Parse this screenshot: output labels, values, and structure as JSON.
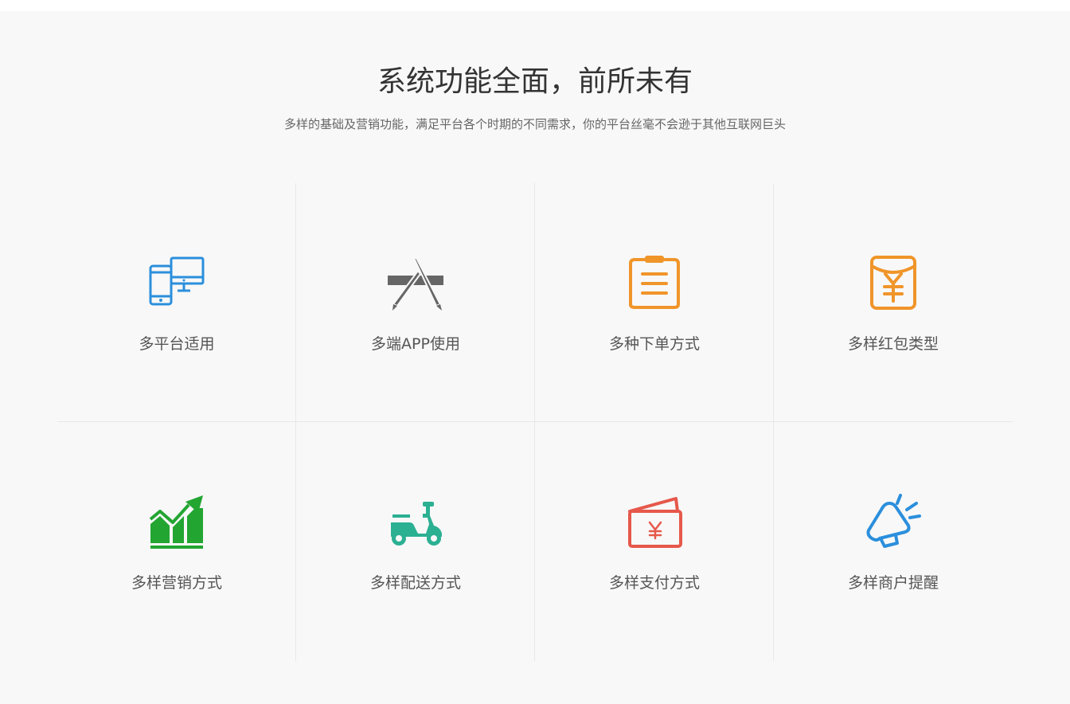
{
  "section": {
    "title": "系统功能全面，前所未有",
    "subtitle": "多样的基础及营销功能，满足平台各个时期的不同需求，你的平台丝毫不会逊于其他互联网巨头"
  },
  "features": [
    {
      "label": "多平台适用",
      "icon": "devices-icon",
      "color": "#2b8fdc"
    },
    {
      "label": "多端APP使用",
      "icon": "app-store-icon",
      "color": "#666666"
    },
    {
      "label": "多种下单方式",
      "icon": "clipboard-icon",
      "color": "#f0952a"
    },
    {
      "label": "多样红包类型",
      "icon": "red-envelope-icon",
      "color": "#f0952a"
    },
    {
      "label": "多样营销方式",
      "icon": "growth-chart-icon",
      "color": "#23a532"
    },
    {
      "label": "多样配送方式",
      "icon": "scooter-icon",
      "color": "#2bb092"
    },
    {
      "label": "多样支付方式",
      "icon": "wallet-icon",
      "color": "#e6584b"
    },
    {
      "label": "多样商户提醒",
      "icon": "megaphone-icon",
      "color": "#2b8fdc"
    }
  ]
}
